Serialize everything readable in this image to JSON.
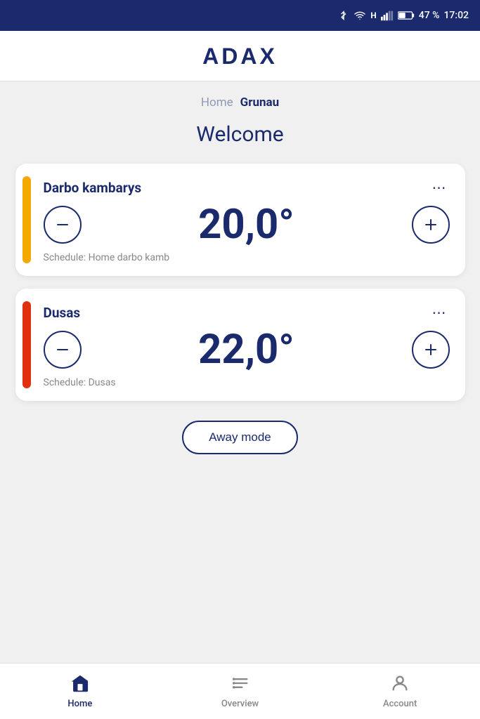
{
  "statusBar": {
    "battery": "47 %",
    "time": "17:02"
  },
  "header": {
    "logo": "ADAX"
  },
  "breadcrumb": {
    "home_label": "Home",
    "current_label": "Grunau"
  },
  "welcome": {
    "title": "Welcome"
  },
  "rooms": [
    {
      "id": "darbo-kambarys",
      "name": "Darbo kambarys",
      "temperature": "20,0°",
      "schedule": "Schedule: Home darbo kamb",
      "stripe_class": "stripe-yellow"
    },
    {
      "id": "dusas",
      "name": "Dusas",
      "temperature": "22,0°",
      "schedule": "Schedule: Dusas",
      "stripe_class": "stripe-orange"
    }
  ],
  "awayMode": {
    "label": "Away mode"
  },
  "bottomNav": {
    "items": [
      {
        "id": "home",
        "label": "Home",
        "active": true
      },
      {
        "id": "overview",
        "label": "Overview",
        "active": false
      },
      {
        "id": "account",
        "label": "Account",
        "active": false
      }
    ]
  },
  "icons": {
    "bluetooth": "&#x1F4F6;",
    "wifi": "&#x1F4F6;"
  }
}
